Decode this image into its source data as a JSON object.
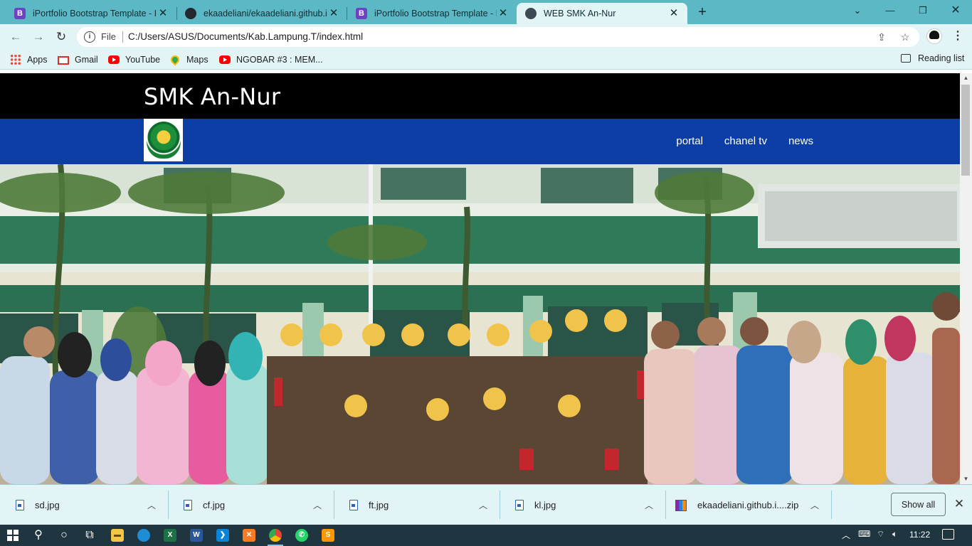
{
  "browser": {
    "tabs": [
      {
        "title": "iPortfolio Bootstrap Template - In",
        "icon": "bootstrap-icon"
      },
      {
        "title": "ekaadeliani/ekaadeliani.github.io",
        "icon": "github-icon"
      },
      {
        "title": "iPortfolio Bootstrap Template - In",
        "icon": "bootstrap-icon"
      },
      {
        "title": "WEB SMK An-Nur",
        "icon": "globe-icon",
        "active": true
      }
    ],
    "tab_favicon_letter": "B",
    "address": {
      "scheme_label": "File",
      "url": "C:/Users/ASUS/Documents/Kab.Lampung.T/index.html"
    },
    "bookmarks": [
      "Apps",
      "Gmail",
      "YouTube",
      "Maps",
      "NGOBAR #3 : MEM..."
    ],
    "reading_list": "Reading list"
  },
  "page": {
    "site_title": "SMK An-Nur",
    "nav": [
      "portal",
      "chanel tv",
      "news"
    ],
    "colors": {
      "header_bg": "#000000",
      "nav_bg": "#0d3ea6",
      "chrome_accent": "#5bb8c4"
    },
    "hero_image": "group-photo-of-school-staff-and-marching-band-in-front-of-green-school-building"
  },
  "downloads": {
    "items": [
      "sd.jpg",
      "cf.jpg",
      "ft.jpg",
      "kl.jpg",
      "ekaadeliani.github.i....zip"
    ],
    "show_all": "Show all"
  },
  "taskbar": {
    "apps": [
      "start-icon",
      "search-icon",
      "cortana-icon",
      "task-view-icon",
      "file-explorer-icon",
      "edge-icon",
      "excel-icon",
      "word-icon",
      "vscode-icon",
      "xampp-icon",
      "chrome-icon",
      "whatsapp-icon",
      "sublime-icon"
    ],
    "app_letters": {
      "excel": "X",
      "word": "W"
    },
    "clock": "11:22"
  }
}
